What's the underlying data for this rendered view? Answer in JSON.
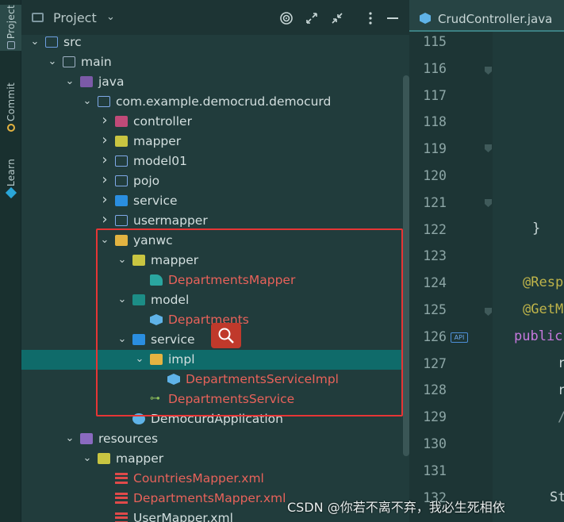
{
  "sidebar_tabs": [
    "Project",
    "Commit",
    "Learn"
  ],
  "panel": {
    "title": "Project",
    "dropdown_glyph": "⌄"
  },
  "tree": [
    {
      "label": "src",
      "depth": 1,
      "icon": "source-folder-icon",
      "expanded": true,
      "color": "plain"
    },
    {
      "label": "main",
      "depth": 2,
      "icon": "folder-icon",
      "expanded": true,
      "color": "plain"
    },
    {
      "label": "java",
      "depth": 3,
      "icon": "java-source-folder-icon",
      "expanded": true,
      "color": "plain"
    },
    {
      "label": "com.example.democrud.democurd",
      "depth": 4,
      "icon": "package-icon",
      "expanded": true,
      "color": "plain"
    },
    {
      "label": "controller",
      "depth": 5,
      "icon": "controller-package-icon",
      "expanded": false,
      "color": "plain"
    },
    {
      "label": "mapper",
      "depth": 5,
      "icon": "mapper-package-icon",
      "expanded": false,
      "color": "plain"
    },
    {
      "label": "model01",
      "depth": 5,
      "icon": "package-icon",
      "expanded": false,
      "color": "plain"
    },
    {
      "label": "pojo",
      "depth": 5,
      "icon": "package-icon",
      "expanded": false,
      "color": "plain"
    },
    {
      "label": "service",
      "depth": 5,
      "icon": "service-package-icon",
      "expanded": false,
      "color": "plain"
    },
    {
      "label": "usermapper",
      "depth": 5,
      "icon": "package-icon",
      "expanded": false,
      "color": "plain"
    },
    {
      "label": "yanwc",
      "depth": 5,
      "icon": "yellow-folder-icon",
      "expanded": true,
      "color": "plain"
    },
    {
      "label": "mapper",
      "depth": 6,
      "icon": "mapper-package-icon",
      "expanded": true,
      "color": "plain"
    },
    {
      "label": "DepartmentsMapper",
      "depth": 7,
      "icon": "mybatis-mapper-icon",
      "expanded": null,
      "color": "red"
    },
    {
      "label": "model",
      "depth": 6,
      "icon": "model-package-icon",
      "expanded": true,
      "color": "plain"
    },
    {
      "label": "Departments",
      "depth": 7,
      "icon": "class-icon",
      "expanded": null,
      "color": "red"
    },
    {
      "label": "service",
      "depth": 6,
      "icon": "service-package-icon",
      "expanded": true,
      "color": "plain"
    },
    {
      "label": "impl",
      "depth": 7,
      "icon": "yellow-folder-icon",
      "expanded": true,
      "color": "plain",
      "selected": true
    },
    {
      "label": "DepartmentsServiceImpl",
      "depth": 8,
      "icon": "class-icon",
      "expanded": null,
      "color": "red"
    },
    {
      "label": "DepartmentsService",
      "depth": 7,
      "icon": "interface-icon",
      "expanded": null,
      "color": "red"
    },
    {
      "label": "DemocurdApplication",
      "depth": 6,
      "icon": "spring-app-icon",
      "expanded": null,
      "color": "plain"
    },
    {
      "label": "resources",
      "depth": 3,
      "icon": "resources-folder-icon",
      "expanded": true,
      "color": "plain"
    },
    {
      "label": "mapper",
      "depth": 4,
      "icon": "mapper-package-icon",
      "expanded": true,
      "color": "plain"
    },
    {
      "label": "CountriesMapper.xml",
      "depth": 5,
      "icon": "xml-icon",
      "expanded": null,
      "color": "red"
    },
    {
      "label": "DepartmentsMapper.xml",
      "depth": 5,
      "icon": "xml-icon",
      "expanded": null,
      "color": "red"
    },
    {
      "label": "UserMapper.xml",
      "depth": 5,
      "icon": "xml-icon",
      "expanded": null,
      "color": "plain"
    }
  ],
  "editor": {
    "tab_name": "CrudController.java",
    "line_numbers": [
      "115",
      "116",
      "117",
      "118",
      "119",
      "120",
      "121",
      "122",
      "123",
      "124",
      "125",
      "126",
      "127",
      "128",
      "129",
      "130",
      "131",
      "132"
    ],
    "code_fragments": {
      "line122": "}",
      "line124": "@Resp",
      "line125": "@GetM",
      "line126": "public",
      "line127": "r",
      "line128": "r",
      "line129": "/",
      "line132": "St"
    },
    "api_badge": "API"
  },
  "watermark": "CSDN @你若不离不弃，我必生死相依",
  "colors": {
    "accent_selection": "#0f6b6a",
    "highlight_box": "#e63535",
    "vcs_new_file": "#e8625a"
  }
}
